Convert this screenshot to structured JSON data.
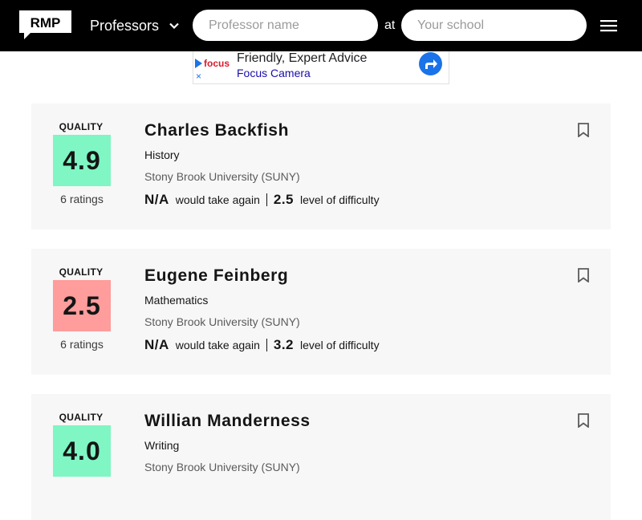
{
  "header": {
    "logo_text": "RMP",
    "nav_dropdown_label": "Professors",
    "search_prof_placeholder": "Professor name",
    "at_label": "at",
    "search_school_placeholder": "Your school",
    "icons": [
      "chevron-down-icon",
      "hamburger-menu-icon"
    ]
  },
  "ad": {
    "brand": "focus",
    "headline": "Friendly, Expert Advice",
    "subline": "Focus Camera",
    "close": "×"
  },
  "professors": [
    {
      "quality_label": "QUALITY",
      "score": "4.9",
      "ratings": "6 ratings",
      "name": "Charles Backfish",
      "department": "History",
      "school": "Stony Brook University (SUNY)",
      "would_take_again": "N/A",
      "would_take_again_label": "would take again",
      "difficulty": "2.5",
      "difficulty_label": "level of difficulty",
      "score_color": "#7ff6c3"
    },
    {
      "quality_label": "QUALITY",
      "score": "2.5",
      "ratings": "6 ratings",
      "name": "Eugene Feinberg",
      "department": "Mathematics",
      "school": "Stony Brook University (SUNY)",
      "would_take_again": "N/A",
      "would_take_again_label": "would take again",
      "difficulty": "3.2",
      "difficulty_label": "level of difficulty",
      "score_color": "#ff9c9c"
    },
    {
      "quality_label": "QUALITY",
      "score": "4.0",
      "ratings": "",
      "name": "Willian Manderness",
      "department": "Writing",
      "school": "Stony Brook University (SUNY)",
      "would_take_again": "",
      "would_take_again_label": "",
      "difficulty": "",
      "difficulty_label": "",
      "score_color": "#7ff6c3"
    }
  ],
  "colors": {
    "header_bg": "#000000",
    "card_bg": "#f7f7f7",
    "ad_accent": "#1a73e8"
  }
}
